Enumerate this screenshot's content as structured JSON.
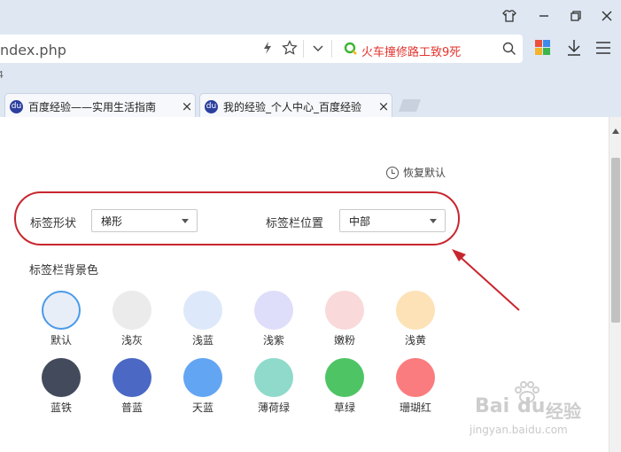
{
  "browser": {
    "address_text": "ndex.php",
    "search_text": "火车撞修路工致9死",
    "bookmark_fragment": "4",
    "tabs": [
      {
        "label": "百度经验——实用生活指南",
        "icon_text": "du"
      },
      {
        "label": "我的经验_个人中心_百度经验",
        "icon_text": "du"
      }
    ]
  },
  "settings": {
    "reset_label": "恢复默认",
    "tab_shape_label": "标签形状",
    "tab_shape_value": "梯形",
    "tab_position_label": "标签栏位置",
    "tab_position_value": "中部",
    "bg_color_label": "标签栏背景色",
    "colors": [
      {
        "label": "默认",
        "color": "#e8eef8"
      },
      {
        "label": "浅灰",
        "color": "#ebebeb"
      },
      {
        "label": "浅蓝",
        "color": "#dde9fa"
      },
      {
        "label": "浅紫",
        "color": "#dedefa"
      },
      {
        "label": "嫩粉",
        "color": "#f9d9d9"
      },
      {
        "label": "浅黄",
        "color": "#fce2b6"
      },
      {
        "label": "蓝铁",
        "color": "#434a5b"
      },
      {
        "label": "普蓝",
        "color": "#4a68c4"
      },
      {
        "label": "天蓝",
        "color": "#62a5f3"
      },
      {
        "label": "薄荷绿",
        "color": "#8fdaca"
      },
      {
        "label": "草绿",
        "color": "#4fc465"
      },
      {
        "label": "珊瑚红",
        "color": "#fb7c7e"
      }
    ]
  },
  "watermark": {
    "brand": "Bai",
    "brand_du": "du",
    "brand_cn": "经验",
    "url": "jingyan.baidu.com"
  },
  "accent_colors": {
    "highlight": "#c8262e",
    "selected_ring": "#4a9ae8"
  }
}
